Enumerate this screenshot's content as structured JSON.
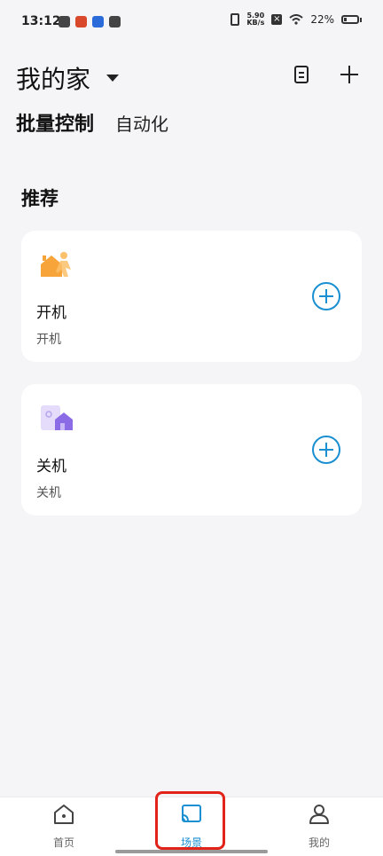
{
  "status": {
    "time": "13:12",
    "speed_value": "5.90",
    "speed_unit": "KB/s",
    "battery_percent": "22%",
    "battery_level": 0.22
  },
  "header": {
    "title": "我的家"
  },
  "tabs": {
    "batch": "批量控制",
    "automation": "自动化"
  },
  "recommend": {
    "title": "推荐",
    "cards": [
      {
        "name": "开机",
        "desc": "开机"
      },
      {
        "name": "关机",
        "desc": "关机"
      }
    ]
  },
  "nav": {
    "home": "首页",
    "scene": "场景",
    "mine": "我的"
  },
  "colors": {
    "accent": "#1a8fd1",
    "highlight": "#e2231a",
    "background": "#f5f5f7"
  }
}
